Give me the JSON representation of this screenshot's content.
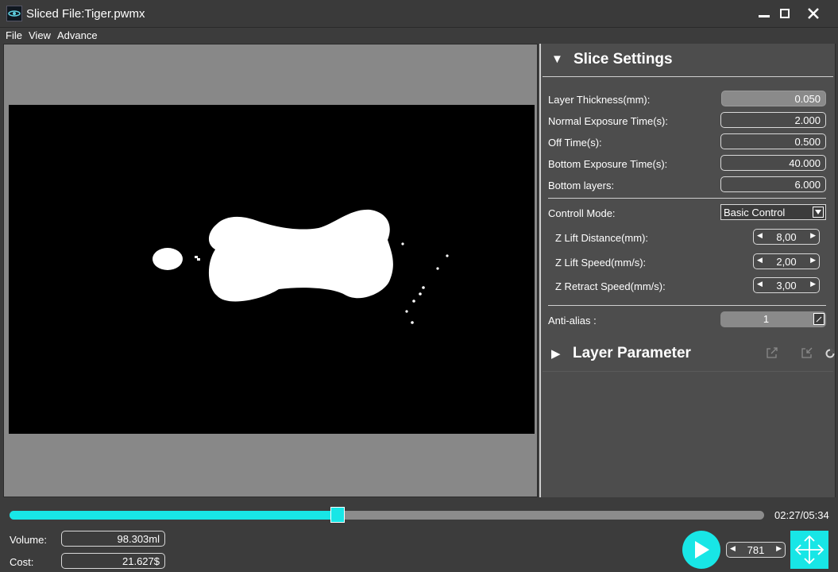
{
  "window": {
    "title": "Sliced File:Tiger.pwmx",
    "app_icon": "photon-logo-icon"
  },
  "menu": [
    "File",
    "View",
    "Advance"
  ],
  "slice_settings": {
    "title": "Slice Settings",
    "layer_thickness": {
      "label": "Layer Thickness(mm):",
      "value": "0.050"
    },
    "normal_exposure": {
      "label": "Normal Exposure Time(s):",
      "value": "2.000"
    },
    "off_time": {
      "label": "Off Time(s):",
      "value": "0.500"
    },
    "bottom_exposure": {
      "label": "Bottom Exposure Time(s):",
      "value": "40.000"
    },
    "bottom_layers": {
      "label": "Bottom layers:",
      "value": "6.000"
    },
    "control_mode": {
      "label": "Controll Mode:",
      "value": "Basic Control"
    },
    "z_lift_distance": {
      "label": "Z Lift Distance(mm):",
      "value": "8,00"
    },
    "z_lift_speed": {
      "label": "Z Lift Speed(mm/s):",
      "value": "2,00"
    },
    "z_retract_speed": {
      "label": "Z Retract Speed(mm/s):",
      "value": "3,00"
    },
    "anti_alias": {
      "label": "Anti-alias :",
      "value": "1"
    }
  },
  "layer_parameter": {
    "title": "Layer Parameter"
  },
  "playback": {
    "progress": 0.435,
    "time": "02:27/05:34",
    "layer": "781",
    "volume": {
      "label": "Volume:",
      "value": "98.303ml"
    },
    "cost": {
      "label": "Cost:",
      "value": "21.627$"
    }
  },
  "colors": {
    "accent": "#18e6e6",
    "panel": "#4d4d4d",
    "background": "#3c3c3c",
    "viewport": "#888888"
  }
}
